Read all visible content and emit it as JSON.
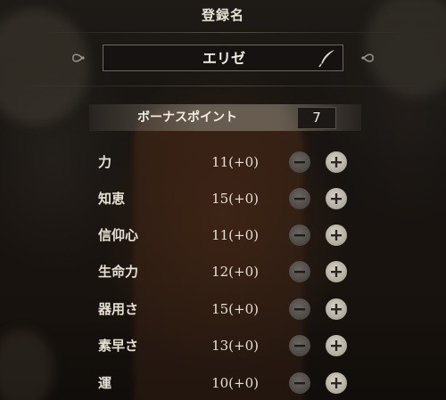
{
  "header": {
    "title": "登録名"
  },
  "name_field": {
    "value": "エリゼ"
  },
  "bonus": {
    "label": "ボーナスポイント",
    "value": "7"
  },
  "stats": [
    {
      "label": "力",
      "value": "11(+0)"
    },
    {
      "label": "知恵",
      "value": "15(+0)"
    },
    {
      "label": "信仰心",
      "value": "11(+0)"
    },
    {
      "label": "生命力",
      "value": "12(+0)"
    },
    {
      "label": "器用さ",
      "value": "15(+0)"
    },
    {
      "label": "素早さ",
      "value": "13(+0)"
    },
    {
      "label": "運",
      "value": "10(+0)"
    }
  ],
  "icons": [
    "quill-icon",
    "left-ornament-icon",
    "right-ornament-icon",
    "minus-icon",
    "plus-icon"
  ],
  "colors": {
    "text": "#e6e0d4",
    "plus_button": "#c9c2b6",
    "minus_button": "#55504b"
  }
}
